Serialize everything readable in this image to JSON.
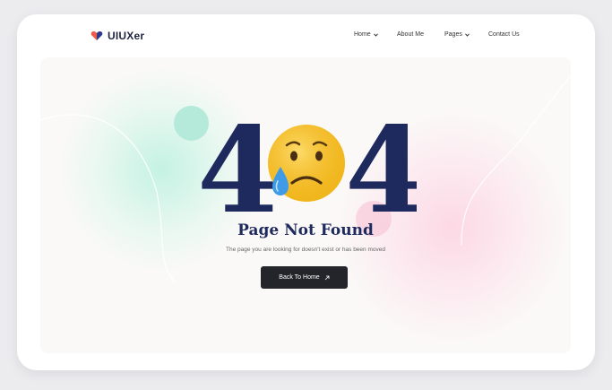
{
  "brand": {
    "name": "UIUXer",
    "icon": "heart-logo-icon"
  },
  "nav": {
    "items": [
      {
        "label": "Home",
        "has_dropdown": true
      },
      {
        "label": "About Me",
        "has_dropdown": false
      },
      {
        "label": "Pages",
        "has_dropdown": true
      },
      {
        "label": "Contact Us",
        "has_dropdown": false
      }
    ]
  },
  "hero": {
    "code_left": "4",
    "code_right": "4",
    "emoji": "sad-crying-face-icon",
    "title": "Page Not Found",
    "subtitle": "The page you are looking for doesn't exist or has been moved",
    "button_label": "Back To Home",
    "button_icon": "arrow-up-right-icon"
  },
  "colors": {
    "accent_navy": "#1e2a5e",
    "button_bg": "#23252b",
    "mint": "#b5eadb",
    "pink": "#f7bed2",
    "emoji_yellow": "#f6c22b"
  }
}
